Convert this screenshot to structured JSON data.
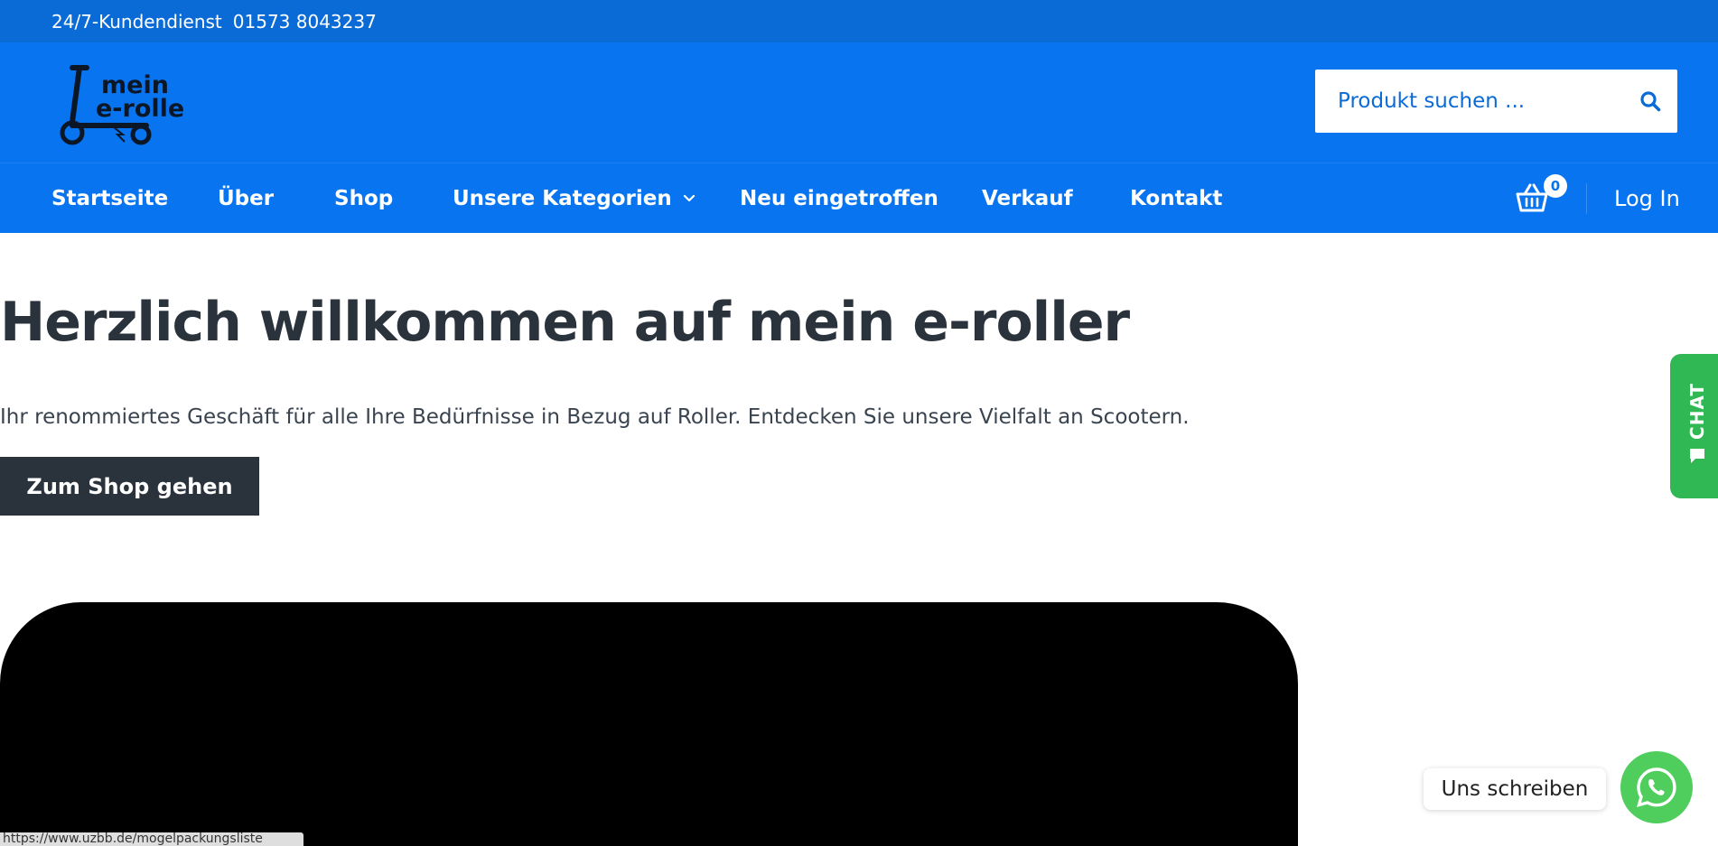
{
  "topbar": {
    "service_label": "24/7-Kundendienst",
    "phone": "01573 8043237"
  },
  "header": {
    "logo_text_line1": "mein",
    "logo_text_line2": "e-roller",
    "search": {
      "placeholder": "Produkt suchen ...",
      "value": ""
    }
  },
  "nav": {
    "items": [
      {
        "label": "Startseite"
      },
      {
        "label": "Über"
      },
      {
        "label": "Shop"
      },
      {
        "label": "Unsere Kategorien"
      },
      {
        "label": "Neu eingetroffen"
      },
      {
        "label": "Verkauf"
      },
      {
        "label": "Kontakt"
      }
    ],
    "cart_count": "0",
    "login_label": "Log In"
  },
  "hero": {
    "title": "Herzlich willkommen auf mein e-roller",
    "subtitle": "Ihr renommiertes Geschäft für alle Ihre Bedürfnisse in Bezug auf Roller. Entdecken Sie unsere Vielfalt an Scootern.",
    "cta_label": "Zum Shop gehen"
  },
  "widgets": {
    "chat_tab_label": "CHAT",
    "whatsapp_label": "Uns schreiben"
  },
  "statusbar": {
    "url": "https://www.uzbb.de/mogelpackungsliste"
  },
  "colors": {
    "topbar": "#0a6bd7",
    "header": "#0874ef",
    "dark": "#2a323c",
    "chat_green": "#2fb853",
    "whatsapp_green": "#4fce5d"
  },
  "icons": {
    "search": "search-icon",
    "cart": "cart-icon",
    "chevron": "chevron-down-icon",
    "chat": "chat-bubble-icon",
    "whatsapp": "whatsapp-icon"
  }
}
